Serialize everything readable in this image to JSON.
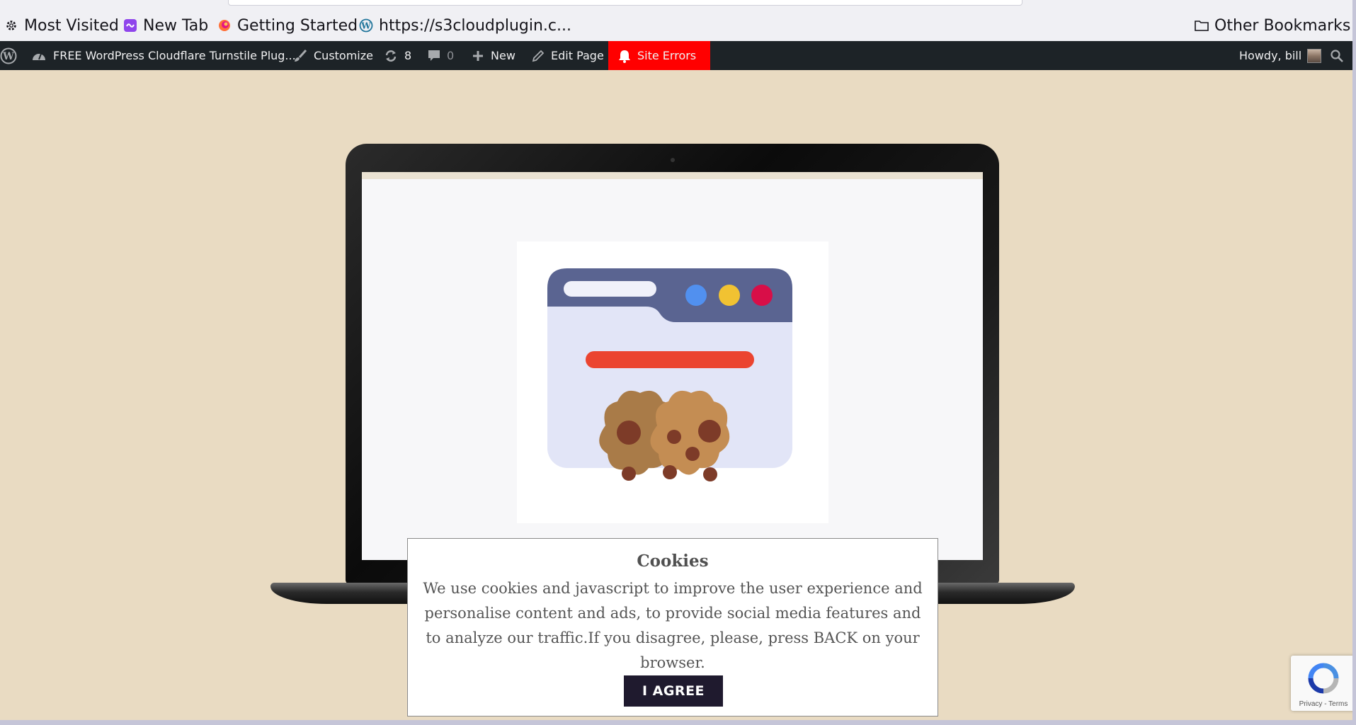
{
  "bookmarks": {
    "items": [
      {
        "label": "Most Visited",
        "icon": "gear-icon"
      },
      {
        "label": "New Tab",
        "icon": "new-tab-icon"
      },
      {
        "label": "Getting Started",
        "icon": "firefox-icon"
      },
      {
        "label": "https://s3cloudplugin.c...",
        "icon": "wordpress-icon"
      }
    ],
    "other": {
      "label": "Other Bookmarks",
      "icon": "folder-icon"
    }
  },
  "adminbar": {
    "site_name": "FREE WordPress Cloudflare Turnstile Plug...",
    "customize": "Customize",
    "updates_count": "8",
    "comments_count": "0",
    "new": "New",
    "edit_page": "Edit Page",
    "site_errors": "Site Errors",
    "howdy": "Howdy, bill"
  },
  "cookie": {
    "title": "Cookies",
    "text": "We use cookies and javascript to improve the user experience and personalise content and ads, to provide social media features and to analyze our traffic.If you disagree, please, press BACK on your browser.",
    "button": "I AGREE"
  },
  "recaptcha": {
    "terms": "Privacy - Terms"
  },
  "colors": {
    "page_bg": "#e9dbc2",
    "adminbar_bg": "#1d2327",
    "site_errors_bg": "#ff0000",
    "agree_button": "#1f1a2e"
  }
}
